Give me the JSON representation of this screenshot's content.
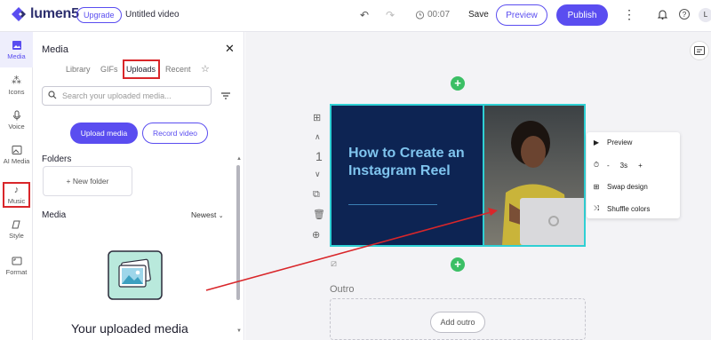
{
  "header": {
    "brand": "lumen5",
    "upgrade_label": "Upgrade",
    "video_title": "Untitled video",
    "duration": "00:07",
    "save_label": "Save",
    "preview_label": "Preview",
    "publish_label": "Publish",
    "avatar_initial": "L",
    "brand_color": "#5a4df0"
  },
  "rail": {
    "items": [
      {
        "label": "Media",
        "icon": "image-icon"
      },
      {
        "label": "Icons",
        "icon": "shapes-icon"
      },
      {
        "label": "Voice",
        "icon": "microphone-icon"
      },
      {
        "label": "AI Media",
        "icon": "ai-image-icon"
      },
      {
        "label": "Music",
        "icon": "music-note-icon"
      },
      {
        "label": "Style",
        "icon": "style-icon"
      },
      {
        "label": "Format",
        "icon": "format-icon"
      }
    ]
  },
  "panel": {
    "title": "Media",
    "tabs": [
      "Library",
      "GIFs",
      "Uploads",
      "Recent",
      "☆"
    ],
    "active_tab": "Uploads",
    "search_placeholder": "Search your uploaded media...",
    "upload_label": "Upload media",
    "record_label": "Record video",
    "folders_label": "Folders",
    "new_folder_label": "+ New folder",
    "media_label": "Media",
    "sort_label": "Newest",
    "empty_text": "Your uploaded media"
  },
  "scene": {
    "number": "1",
    "title": "How to Create an Instagram Reel",
    "context_menu": {
      "preview": "Preview",
      "minus": "-",
      "duration": "3s",
      "plus": "+",
      "swap": "Swap design",
      "shuffle": "Shuffle colors"
    },
    "outro_label": "Outro",
    "add_outro_label": "Add outro"
  }
}
